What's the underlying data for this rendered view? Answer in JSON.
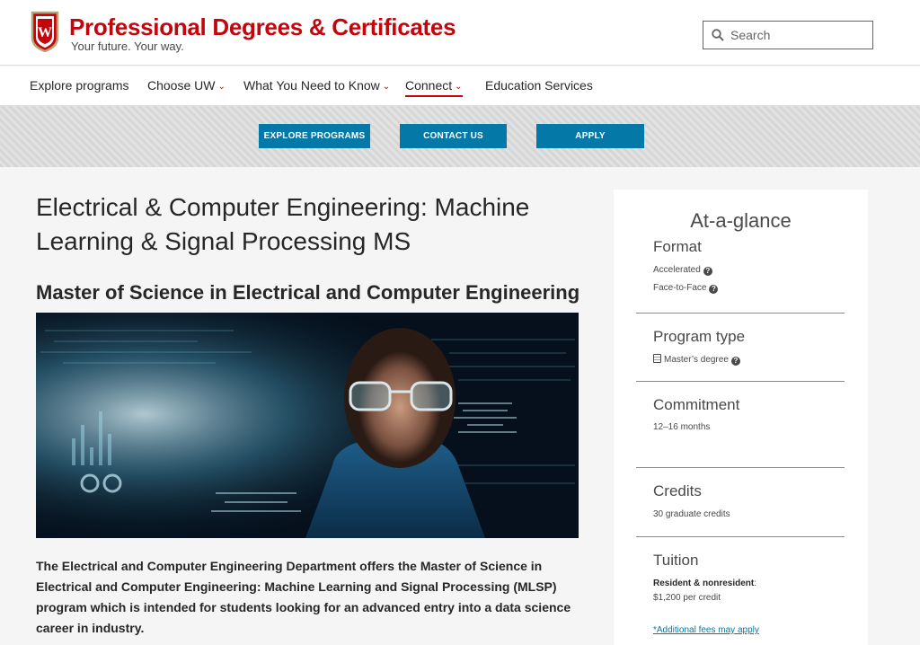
{
  "header": {
    "title": "Professional Degrees & Certificates",
    "tagline": "Your future. Your way.",
    "crest_letter": "W",
    "search_placeholder": "Search"
  },
  "nav": {
    "items": [
      {
        "label": "Explore programs",
        "dropdown": false,
        "active": false
      },
      {
        "label": "Choose UW",
        "dropdown": true,
        "active": false
      },
      {
        "label": "What You Need to Know",
        "dropdown": true,
        "active": false
      },
      {
        "label": "Connect",
        "dropdown": true,
        "active": true
      },
      {
        "label": "Education Services",
        "dropdown": false,
        "active": false
      }
    ]
  },
  "cta": {
    "explore": "EXPLORE PROGRAMS",
    "contact": "CONTACT US",
    "apply": "APPLY"
  },
  "main": {
    "title": "Electrical & Computer Engineering: Machine Learning & Signal Processing MS",
    "subtitle": "Master of Science in Electrical and Computer Engineering",
    "body": "The Electrical and Computer Engineering Department offers the Master of Science in Electrical and Computer Engineering: Machine Learning and Signal Processing (MLSP) program which is intended for students looking for an advanced entry into a data science career in industry."
  },
  "glance": {
    "title": "At-a-glance",
    "format_title": "Format",
    "format_1": "Accelerated",
    "format_2": "Face-to-Face",
    "type_title": "Program type",
    "type_value": "Master’s degree",
    "commitment_title": "Commitment",
    "commitment_value": "12–16 months",
    "credits_title": "Credits",
    "credits_value": "30 graduate credits",
    "tuition_title": "Tuition",
    "tuition_label": "Resident & nonresident",
    "tuition_value": "$1,200 per credit",
    "fees_link": "*Additional fees may apply"
  },
  "colors": {
    "brand_red": "#c5050c",
    "button_blue": "#0479a8",
    "text_dark": "#282728",
    "page_bg": "#f5f5f5"
  },
  "icons": [
    "crest-logo",
    "search-icon",
    "chevron-down-icon",
    "help-icon",
    "diploma-icon"
  ]
}
